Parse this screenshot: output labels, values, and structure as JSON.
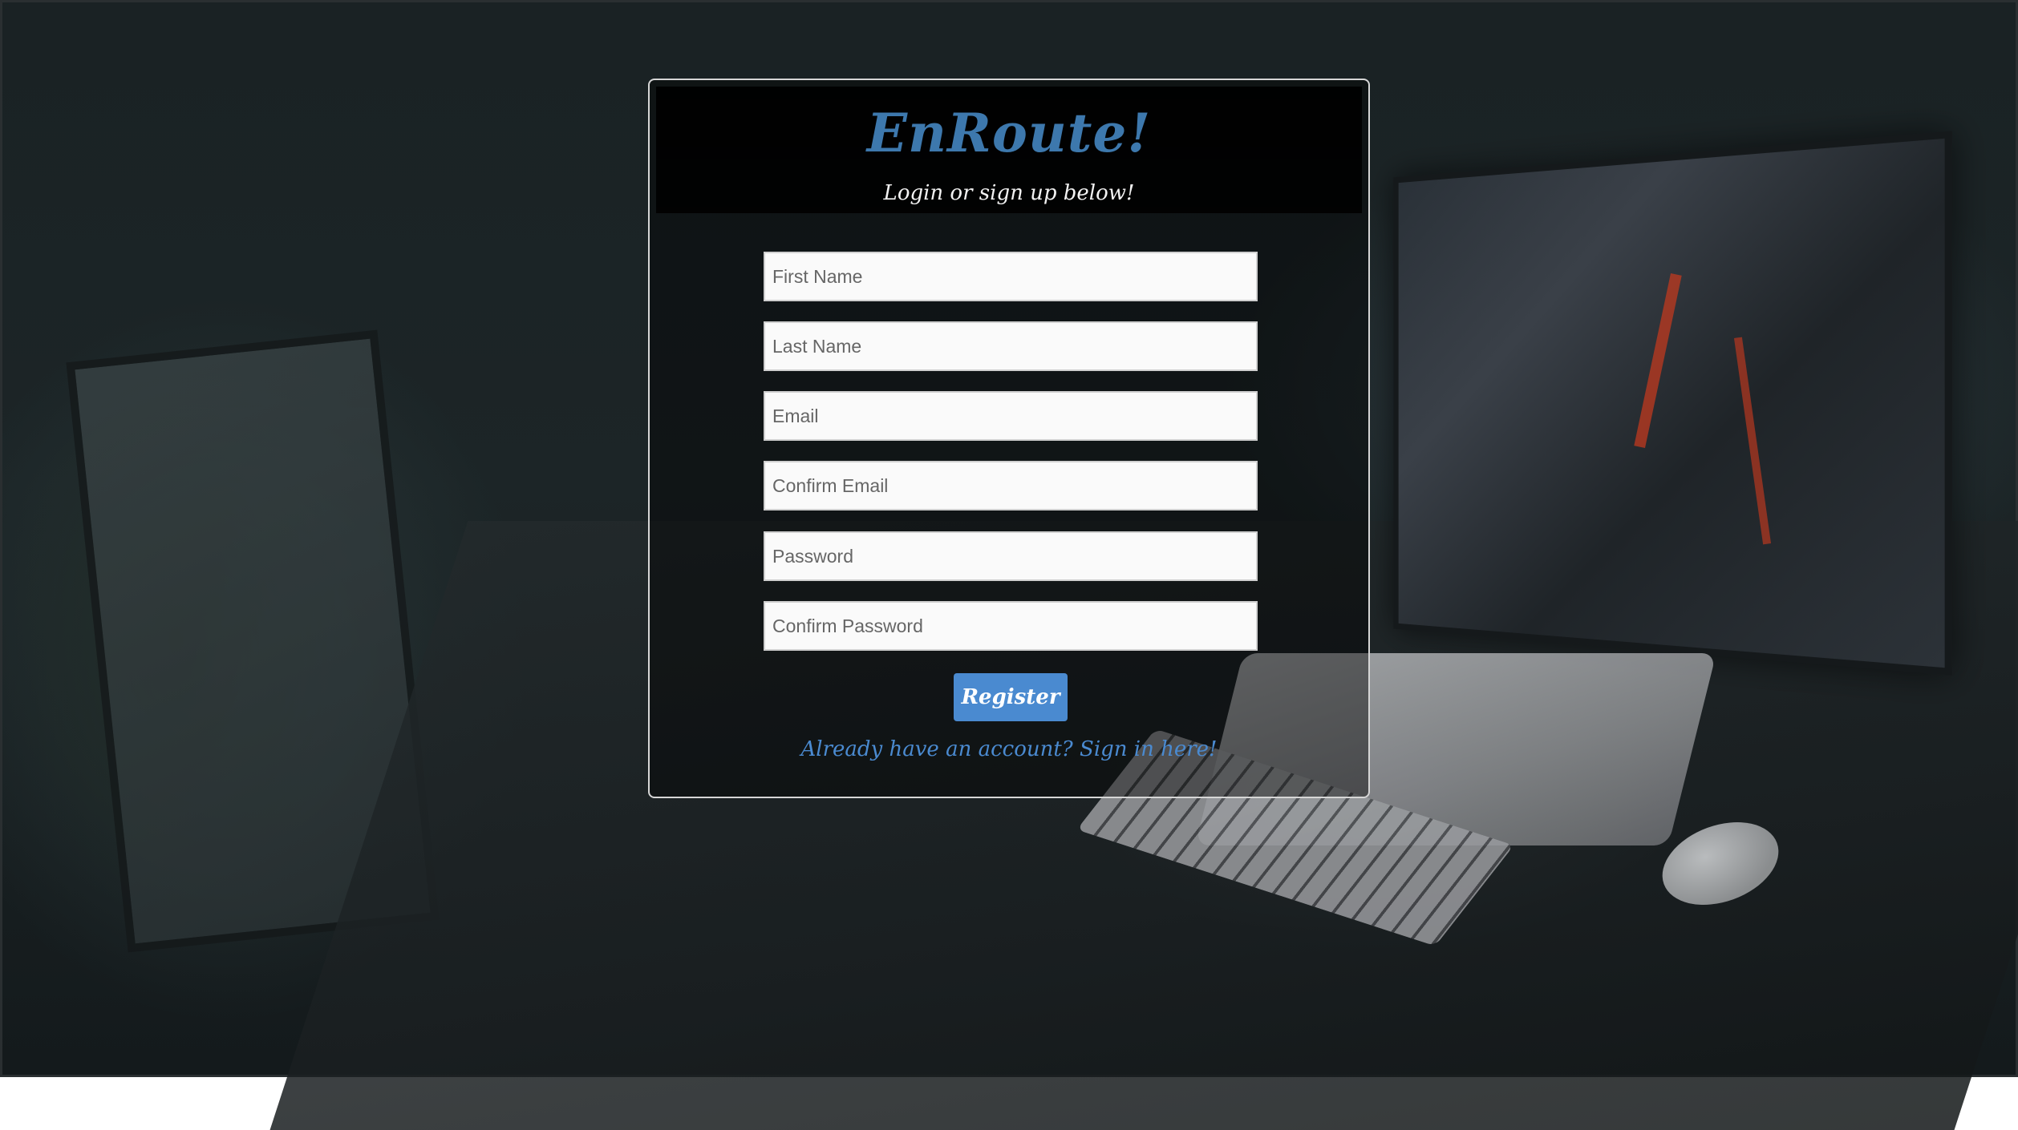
{
  "header": {
    "title": "EnRoute!",
    "subtitle": "Login or sign up below!"
  },
  "form": {
    "fields": [
      {
        "placeholder": "First Name",
        "value": ""
      },
      {
        "placeholder": "Last Name",
        "value": ""
      },
      {
        "placeholder": "Email",
        "value": ""
      },
      {
        "placeholder": "Confirm Email",
        "value": ""
      },
      {
        "placeholder": "Password",
        "value": ""
      },
      {
        "placeholder": "Confirm Password",
        "value": ""
      }
    ],
    "register_label": "Register",
    "signin_link": "Already have an account? Sign in here!"
  },
  "colors": {
    "title": "#3d78ad",
    "button": "#4a8ad0",
    "link": "#4a8ad0"
  }
}
